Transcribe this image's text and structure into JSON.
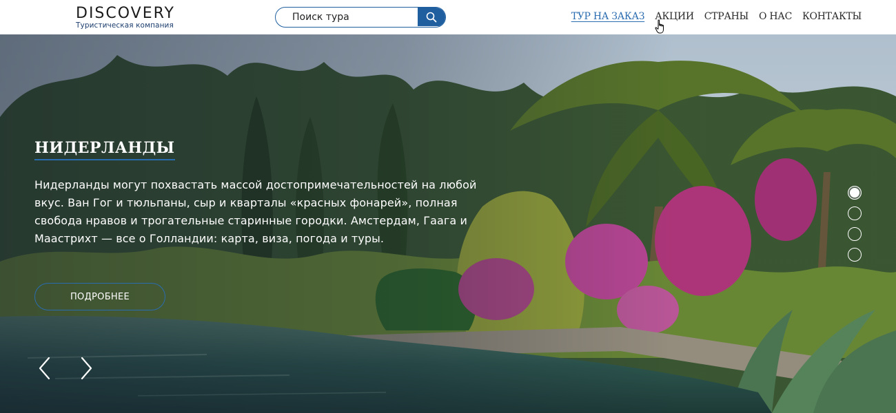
{
  "header": {
    "logo": {
      "title": "DISCOVERY",
      "subtitle": "Туристическая компания"
    },
    "search": {
      "placeholder": "Поиск тура",
      "icon": "search-icon"
    },
    "nav": {
      "items": [
        {
          "label": "ТУР НА ЗАКАЗ",
          "active": true
        },
        {
          "label": "АКЦИИ",
          "active": false
        },
        {
          "label": "СТРАНЫ",
          "active": false
        },
        {
          "label": "О НАС",
          "active": false
        },
        {
          "label": "КОНТАКТЫ",
          "active": false
        }
      ]
    }
  },
  "hero": {
    "title": "НИДЕРЛАНДЫ",
    "description": "Нидерланды могут похвастать массой достопримечательностей на любой вкус. Ван Гог и тюльпаны, сыр и кварталы «красных фонарей», полная свобода нравов и трогательные старинные городки. Амстердам, Гаага и Маастрихт — все о Голландии: карта, виза, погода и туры.",
    "button_label": "ПОДРОБНЕЕ",
    "slides": {
      "count": 4,
      "active_index": 0
    },
    "prev_icon": "chevron-left-icon",
    "next_icon": "chevron-right-icon"
  },
  "colors": {
    "accent": "#1f5fa0",
    "nav_active": "#2a6cb0",
    "header_bg": "#ffffff",
    "text_light": "#ffffff"
  }
}
